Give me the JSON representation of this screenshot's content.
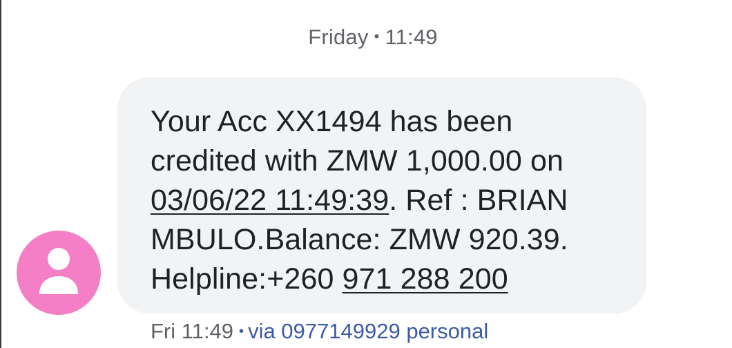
{
  "header": {
    "day": "Friday",
    "separator": "•",
    "time": "11:49"
  },
  "contact": {
    "avatar_icon": "person-icon",
    "avatar_color": "#f47fc6"
  },
  "message": {
    "line1": "Your Acc XX1494 has been",
    "line2": "credited with ZMW 1,000.00 on",
    "datetime_link": "03/06/22 11:49:39",
    "line3_rest": ". Ref : BRIAN",
    "line4": "MBULO.Balance: ZMW 920.39.",
    "helpline_label": "Helpline:+260 ",
    "helpline_link": "971 288 200",
    "bubble_color": "#f1f3f4"
  },
  "meta": {
    "time": "Fri 11:49",
    "separator": "•",
    "via": "via 0977149929 personal",
    "via_color": "#3c5aa6"
  }
}
